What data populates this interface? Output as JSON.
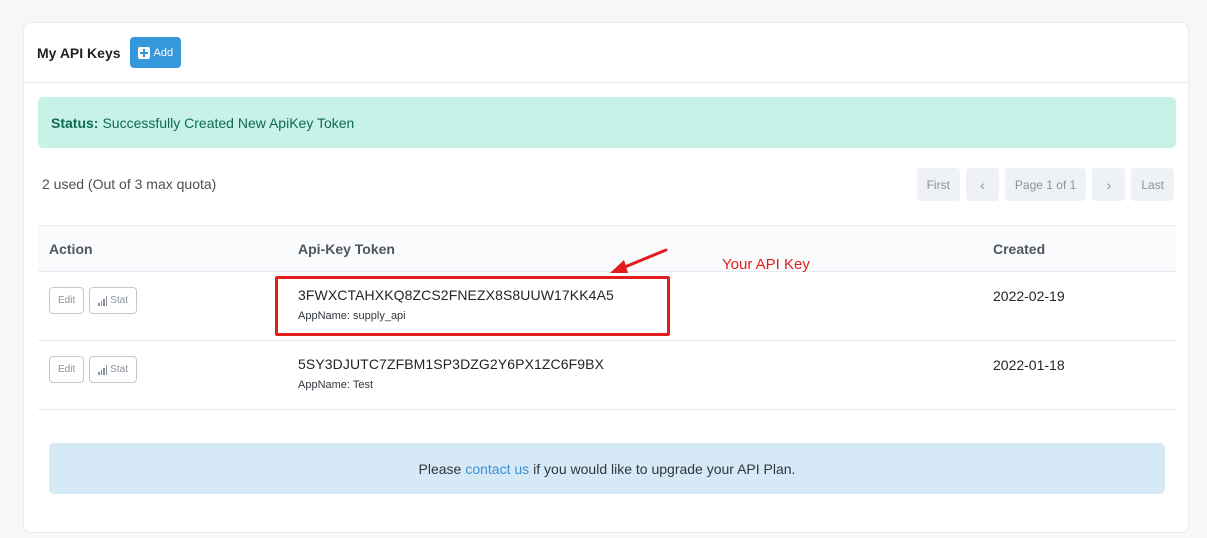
{
  "header": {
    "title": "My API Keys",
    "add_label": "Add"
  },
  "status": {
    "label": "Status:",
    "message": "Successfully Created New ApiKey Token"
  },
  "quota": {
    "text": "2 used (Out of 3 max quota)"
  },
  "pagination": {
    "first": "First",
    "prev": "‹",
    "page": "Page 1 of 1",
    "next": "›",
    "last": "Last"
  },
  "table": {
    "columns": [
      "Action",
      "Api-Key Token",
      "Created"
    ],
    "edit_label": "Edit",
    "stat_label": "Stat",
    "rows": [
      {
        "token": "3FWXCTAHXKQ8ZCS2FNEZX8S8UUW17KK4A5",
        "appname": "AppName: supply_api",
        "created": "2022-02-19"
      },
      {
        "token": "5SY3DJUTC7ZFBM1SP3DZG2Y6PX1ZC6F9BX",
        "appname": "AppName: Test",
        "created": "2022-01-18"
      }
    ]
  },
  "annotation": {
    "text": "Your API Key",
    "color": "#e11d1d"
  },
  "info": {
    "before": "Please",
    "link": "contact us",
    "after": "if you would like to upgrade your API Plan."
  },
  "colors": {
    "primary": "#3498db",
    "success_bg": "#c8f1e8",
    "info_bg": "#d6e9f7"
  }
}
